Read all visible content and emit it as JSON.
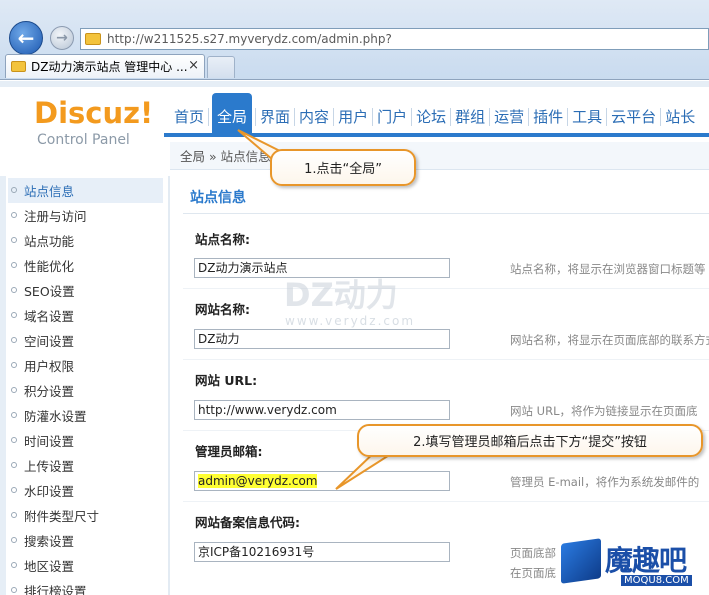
{
  "browser": {
    "url": "http://w211525.s27.myverydz.com/admin.php?",
    "tab_title": "DZ动力演示站点 管理中心 ...",
    "tab_close": "×"
  },
  "header": {
    "logo_text": "Discuz",
    "logo_excl": "!",
    "logo_sub": "Control Panel",
    "menu": [
      "首页",
      "全局",
      "界面",
      "内容",
      "用户",
      "门户",
      "论坛",
      "群组",
      "运营",
      "插件",
      "工具",
      "云平台",
      "站长"
    ],
    "active_menu": "全局"
  },
  "breadcrumb": "全局 » 站点信息",
  "sidebar": {
    "items": [
      "站点信息",
      "注册与访问",
      "站点功能",
      "性能优化",
      "SEO设置",
      "域名设置",
      "空间设置",
      "用户权限",
      "积分设置",
      "防灌水设置",
      "时间设置",
      "上传设置",
      "水印设置",
      "附件类型尺寸",
      "搜索设置",
      "地区设置",
      "排行榜设置"
    ],
    "active": "站点信息"
  },
  "content": {
    "title": "站点信息",
    "fields": [
      {
        "label": "站点名称:",
        "value": "DZ动力演示站点",
        "desc": "站点名称，将显示在浏览器窗口标题等"
      },
      {
        "label": "网站名称:",
        "value": "DZ动力",
        "desc": "网站名称，将显示在页面底部的联系方式"
      },
      {
        "label": "网站 URL:",
        "value": "http://www.verydz.com",
        "desc": "网站 URL，将作为链接显示在页面底"
      },
      {
        "label": "管理员邮箱:",
        "value": "admin@verydz.com",
        "desc": "管理员 E-mail，将作为系统发邮件的"
      },
      {
        "label": "网站备案信息代码:",
        "value": "京ICP备10216931号",
        "desc": "页面底部",
        "desc2": "在页面底"
      }
    ]
  },
  "watermark": {
    "big": "DZ动力",
    "small": "www.verydz.com"
  },
  "callouts": {
    "step1": "1.点击“全局”",
    "step2": "2.填写管理员邮箱后点击下方“提交”按钮"
  },
  "brand": {
    "name": "魔趣吧",
    "sub": "MOQU8.COM"
  },
  "colors": {
    "accent": "#2b7acc",
    "logo": "#f39a1e",
    "callout_border": "#e8962a",
    "highlight": "#ffff33"
  }
}
